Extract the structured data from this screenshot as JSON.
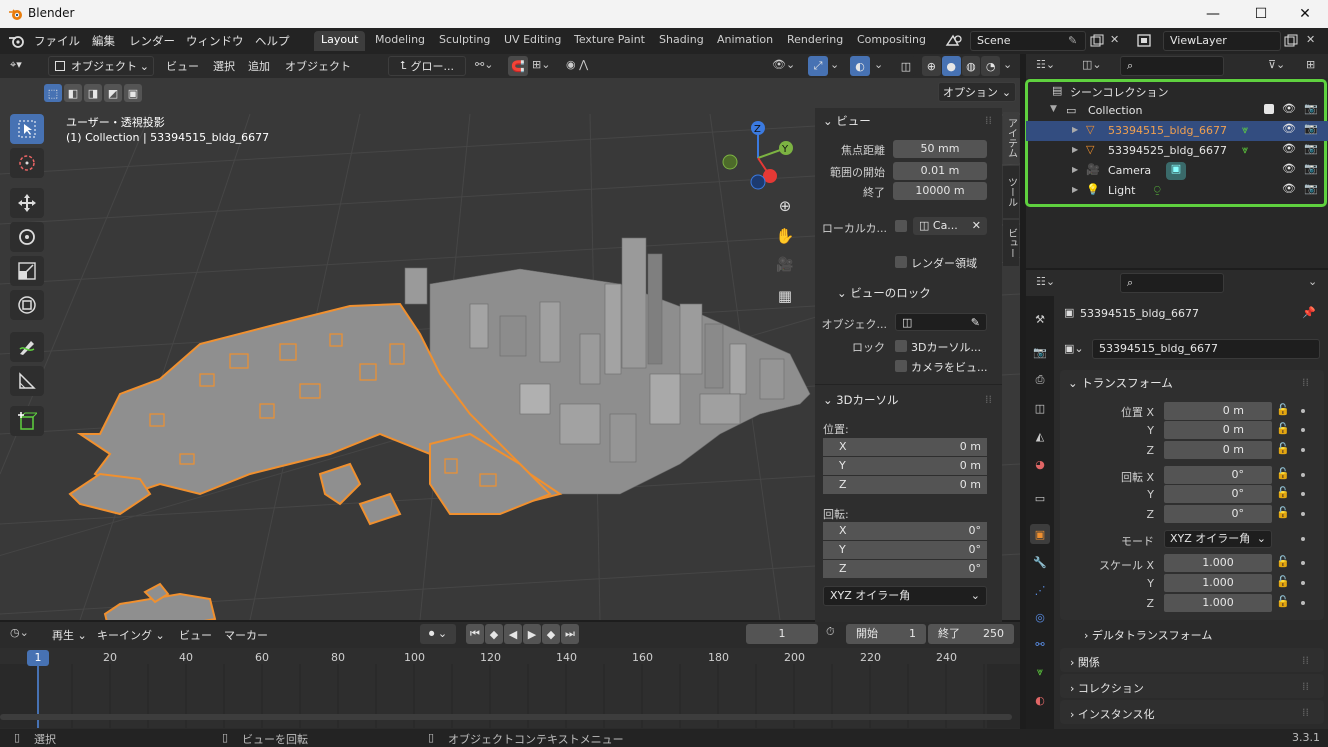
{
  "window": {
    "title": "Blender",
    "minimize": "—",
    "maximize": "☐",
    "close": "✕"
  },
  "menu": [
    "ファイル",
    "編集",
    "レンダー",
    "ウィンドウ",
    "ヘルプ"
  ],
  "workspaces": [
    "Layout",
    "Modeling",
    "Sculpting",
    "UV Editing",
    "Texture Paint",
    "Shading",
    "Animation",
    "Rendering",
    "Compositing"
  ],
  "scene": {
    "name": "Scene",
    "view_layer": "ViewLayer"
  },
  "viewport_header": {
    "mode": "オブジェクト",
    "menus": [
      "ビュー",
      "選択",
      "追加",
      "オブジェクト"
    ],
    "transform_orientation": "グロー...",
    "options_label": "オプション"
  },
  "viewport_info": {
    "projection": "ユーザー・透視投影",
    "context": "(1) Collection | 53394515_bldg_6677"
  },
  "gizmo": {
    "z": "Z",
    "y": "Y"
  },
  "npanel": {
    "view_header": "ビュー",
    "focal_label": "焦点距離",
    "focal_value": "50 mm",
    "clip_start_label": "範囲の開始",
    "clip_start_value": "0.01 m",
    "clip_end_label": "終了",
    "clip_end_value": "10000 m",
    "local_camera_label": "ローカルカ...",
    "local_camera_value": "Ca...",
    "render_region_label": "レンダー領域",
    "view_lock_header": "ビューのロック",
    "lock_object_label": "オブジェク...",
    "lock_label": "ロック",
    "lock_3d_cursor": "3Dカーソル...",
    "camera_to_view": "カメラをビュ...",
    "cursor_header": "3Dカーソル",
    "location_label": "位置:",
    "loc": [
      {
        "axis": "X",
        "value": "0 m"
      },
      {
        "axis": "Y",
        "value": "0 m"
      },
      {
        "axis": "Z",
        "value": "0 m"
      }
    ],
    "rotation_label": "回転:",
    "rot": [
      {
        "axis": "X",
        "value": "0°"
      },
      {
        "axis": "Y",
        "value": "0°"
      },
      {
        "axis": "Z",
        "value": "0°"
      }
    ],
    "rotation_mode": "XYZ オイラー角",
    "tabs": [
      "アイテム",
      "ツール",
      "ビュー"
    ]
  },
  "outliner": {
    "scene_collection": "シーンコレクション",
    "collection": "Collection",
    "items": [
      "53394515_bldg_6677",
      "53394525_bldg_6677",
      "Camera",
      "Light"
    ]
  },
  "properties": {
    "object_name": "53394515_bldg_6677",
    "data_name": "53394515_bldg_6677",
    "transform_header": "トランスフォーム",
    "location_label": "位置 X",
    "location": [
      {
        "axis": "位置 X",
        "value": "0 m"
      },
      {
        "axis": "Y",
        "value": "0 m"
      },
      {
        "axis": "Z",
        "value": "0 m"
      }
    ],
    "rotation": [
      {
        "axis": "回転 X",
        "value": "0°"
      },
      {
        "axis": "Y",
        "value": "0°"
      },
      {
        "axis": "Z",
        "value": "0°"
      }
    ],
    "mode_label": "モード",
    "mode_value": "XYZ オイラー角",
    "scale": [
      {
        "axis": "スケール X",
        "value": "1.000"
      },
      {
        "axis": "Y",
        "value": "1.000"
      },
      {
        "axis": "Z",
        "value": "1.000"
      }
    ],
    "delta_transform": "デルタトランスフォーム",
    "relations": "関係",
    "collections": "コレクション",
    "instancing": "インスタンス化"
  },
  "timeline": {
    "playback": "再生",
    "keying": "キーイング",
    "view": "ビュー",
    "marker": "マーカー",
    "current_frame": "1",
    "start_label": "開始",
    "start": "1",
    "end_label": "終了",
    "end": "250",
    "ticks": [
      "20",
      "40",
      "60",
      "80",
      "100",
      "120",
      "140",
      "160",
      "180",
      "200",
      "220",
      "240"
    ],
    "frame_indicator": "1"
  },
  "status": {
    "select": "選択",
    "rotate_view": "ビューを回転",
    "context_menu": "オブジェクトコンテキストメニュー",
    "version": "3.3.1"
  },
  "colors": {
    "accent_blue": "#4772b3",
    "selection_orange": "#f0902f",
    "highlight_green": "#5fd13f"
  }
}
